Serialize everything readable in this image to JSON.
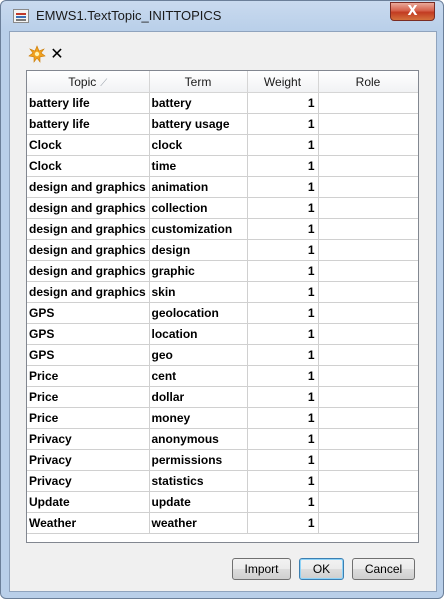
{
  "window": {
    "title": "EMWS1.TextTopic_INITTOPICS",
    "close_glyph": "X",
    "icon": "sas-app-icon"
  },
  "toolbar": {
    "items": [
      {
        "icon": "starburst-add-icon",
        "color": "#f0a020"
      },
      {
        "icon": "delete-x-icon",
        "glyph": "✕"
      }
    ]
  },
  "table": {
    "columns": [
      "Topic",
      "Term",
      "Weight",
      "Role"
    ],
    "sort_indicator": "⟋",
    "rows": [
      {
        "topic": "battery life",
        "term": "battery",
        "weight": "1",
        "role": ""
      },
      {
        "topic": "battery life",
        "term": "battery usage",
        "weight": "1",
        "role": ""
      },
      {
        "topic": "Clock",
        "term": "clock",
        "weight": "1",
        "role": ""
      },
      {
        "topic": "Clock",
        "term": "time",
        "weight": "1",
        "role": ""
      },
      {
        "topic": "design and graphics",
        "term": "animation",
        "weight": "1",
        "role": ""
      },
      {
        "topic": "design and graphics",
        "term": "collection",
        "weight": "1",
        "role": ""
      },
      {
        "topic": "design and graphics",
        "term": "customization",
        "weight": "1",
        "role": ""
      },
      {
        "topic": "design and graphics",
        "term": "design",
        "weight": "1",
        "role": ""
      },
      {
        "topic": "design and graphics",
        "term": "graphic",
        "weight": "1",
        "role": ""
      },
      {
        "topic": "design and graphics",
        "term": "skin",
        "weight": "1",
        "role": ""
      },
      {
        "topic": "GPS",
        "term": "geolocation",
        "weight": "1",
        "role": ""
      },
      {
        "topic": "GPS",
        "term": "location",
        "weight": "1",
        "role": ""
      },
      {
        "topic": "GPS",
        "term": "geo",
        "weight": "1",
        "role": ""
      },
      {
        "topic": "Price",
        "term": "cent",
        "weight": "1",
        "role": ""
      },
      {
        "topic": "Price",
        "term": "dollar",
        "weight": "1",
        "role": ""
      },
      {
        "topic": "Price",
        "term": "money",
        "weight": "1",
        "role": ""
      },
      {
        "topic": "Privacy",
        "term": "anonymous",
        "weight": "1",
        "role": ""
      },
      {
        "topic": "Privacy",
        "term": "permissions",
        "weight": "1",
        "role": ""
      },
      {
        "topic": "Privacy",
        "term": "statistics",
        "weight": "1",
        "role": ""
      },
      {
        "topic": "Update",
        "term": "update",
        "weight": "1",
        "role": ""
      },
      {
        "topic": "Weather",
        "term": "weather",
        "weight": "1",
        "role": ""
      }
    ]
  },
  "buttons": {
    "import_label": "Import",
    "ok_label": "OK",
    "cancel_label": "Cancel"
  }
}
